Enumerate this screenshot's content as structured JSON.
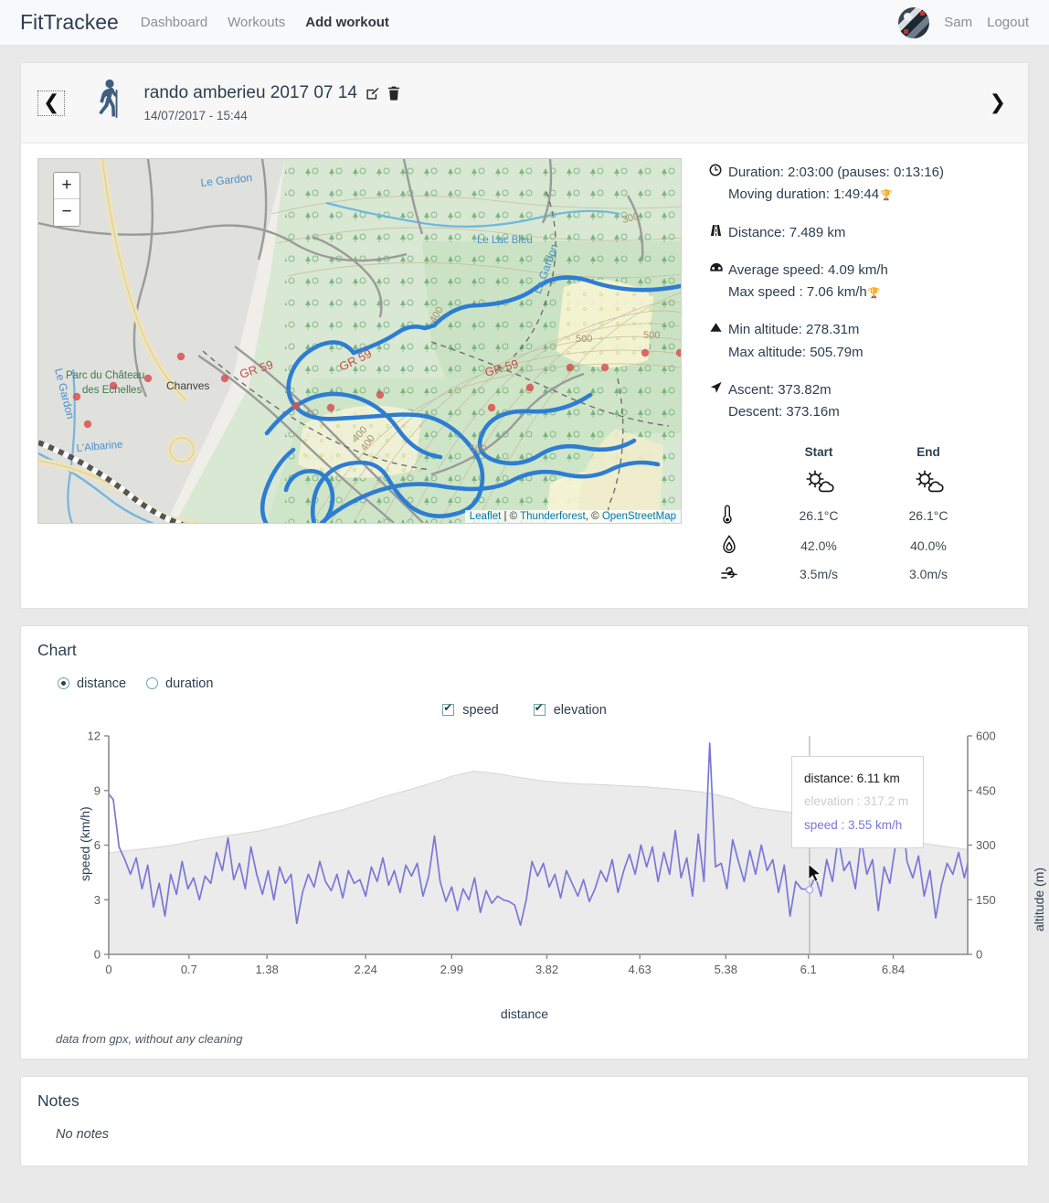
{
  "navbar": {
    "brand": "FitTrackee",
    "links": [
      {
        "label": "Dashboard",
        "active": false
      },
      {
        "label": "Workouts",
        "active": false
      },
      {
        "label": "Add workout",
        "active": true
      }
    ],
    "user": "Sam",
    "logout": "Logout"
  },
  "workout": {
    "prev_label": "❮",
    "next_label": "❯",
    "title": "rando amberieu 2017 07 14",
    "date": "14/07/2017 - 15:44",
    "sport": "hiking"
  },
  "map": {
    "zoom_in": "+",
    "zoom_out": "−",
    "attribution": {
      "leaflet": "Leaflet",
      "sep1": " | © ",
      "thunderforest": "Thunderforest",
      "sep2": ", © ",
      "osm": "OpenStreetMap"
    },
    "labels": [
      "Le Gardon",
      "Le Lac Bleu",
      "Parc du Château",
      "des Echelles",
      "Chanves",
      "L'Albarine",
      "GR 59",
      "300",
      "400",
      "500"
    ]
  },
  "stats": {
    "duration": "Duration: 2:03:00 (pauses: 0:13:16)",
    "moving_duration": "Moving duration: 1:49:44",
    "distance": "Distance: 7.489 km",
    "average_speed": "Average speed: 4.09 km/h",
    "max_speed": "Max speed : 7.06 km/h",
    "min_altitude": "Min altitude: 278.31m",
    "max_altitude": "Max altitude: 505.79m",
    "ascent": "Ascent: 373.82m",
    "descent": "Descent: 373.16m"
  },
  "weather": {
    "col_start": "Start",
    "col_end": "End",
    "icon_start": "sun-cloud",
    "icon_end": "sun-cloud",
    "rows": [
      {
        "icon": "thermometer-icon",
        "start": "26.1°C",
        "end": "26.1°C"
      },
      {
        "icon": "humidity-drop-icon",
        "start": "42.0%",
        "end": "40.0%"
      },
      {
        "icon": "wind-icon",
        "start": "3.5m/s",
        "end": "3.0m/s"
      }
    ]
  },
  "chart": {
    "title": "Chart",
    "radios": [
      {
        "label": "distance",
        "selected": true
      },
      {
        "label": "duration",
        "selected": false
      }
    ],
    "checkboxes": [
      {
        "label": "speed",
        "checked": true
      },
      {
        "label": "elevation",
        "checked": true
      }
    ],
    "note": "data from gpx, without any cleaning",
    "tooltip": {
      "distance": "distance: 6.11 km",
      "elevation": "elevation : 317.2 m",
      "speed": "speed : 3.55 km/h"
    }
  },
  "chart_data": {
    "type": "line",
    "title": "Chart",
    "xlabel": "distance",
    "ylabel": "speed (km/h)",
    "y2label": "altitude (m)",
    "grid": false,
    "legend": [
      "speed",
      "elevation"
    ],
    "legend_position": "top-center",
    "xlim": [
      0,
      7.489
    ],
    "ylim": [
      0,
      12
    ],
    "y2lim": [
      0,
      600
    ],
    "xticks": [
      0,
      0.7,
      1.38,
      2.24,
      2.99,
      3.82,
      4.63,
      5.38,
      6.1,
      6.84
    ],
    "xticklabels": [
      "0",
      "0.7",
      "1.38",
      "2.24",
      "2.99",
      "3.82",
      "4.63",
      "5.38",
      "6.1",
      "6.84"
    ],
    "yticks": [
      0,
      3,
      6,
      9,
      12
    ],
    "yticklabels": [
      "0",
      "3",
      "6",
      "9",
      "12"
    ],
    "y2ticks": [
      0,
      150,
      300,
      450,
      600
    ],
    "y2ticklabels": [
      "0",
      "150",
      "300",
      "450",
      "600"
    ],
    "colors": {
      "speed": "#7b76d6",
      "elevation": "#ebebeb",
      "elevation_line": "#d6d6d6"
    },
    "cursor": {
      "x": 6.11,
      "elevation": 317.2,
      "speed": 3.55
    },
    "series": [
      {
        "name": "elevation",
        "axis": "right",
        "unit": "m",
        "x": [
          0.0,
          0.19,
          0.37,
          0.56,
          0.75,
          0.94,
          1.12,
          1.31,
          1.5,
          1.68,
          1.87,
          2.06,
          2.25,
          2.43,
          2.62,
          2.81,
          3.0,
          3.18,
          3.37,
          3.56,
          3.74,
          3.93,
          4.12,
          4.31,
          4.49,
          4.68,
          4.87,
          5.06,
          5.24,
          5.43,
          5.62,
          5.8,
          5.99,
          6.18,
          6.37,
          6.55,
          6.74,
          6.93,
          7.12,
          7.3,
          7.49
        ],
        "values": [
          279,
          286,
          292,
          300,
          312,
          322,
          330,
          339,
          352,
          368,
          384,
          399,
          418,
          436,
          452,
          470,
          490,
          503,
          497,
          487,
          478,
          472,
          468,
          466,
          463,
          460,
          455,
          450,
          443,
          428,
          404,
          396,
          388,
          372,
          348,
          330,
          318,
          310,
          304,
          296,
          288
        ]
      },
      {
        "name": "speed",
        "axis": "left",
        "unit": "km/h",
        "x": [
          0.0,
          0.04,
          0.09,
          0.14,
          0.19,
          0.24,
          0.29,
          0.34,
          0.39,
          0.44,
          0.49,
          0.54,
          0.59,
          0.64,
          0.69,
          0.74,
          0.79,
          0.84,
          0.89,
          0.94,
          0.99,
          1.04,
          1.09,
          1.14,
          1.19,
          1.24,
          1.29,
          1.34,
          1.39,
          1.44,
          1.49,
          1.54,
          1.59,
          1.64,
          1.69,
          1.74,
          1.79,
          1.84,
          1.89,
          1.94,
          1.99,
          2.04,
          2.09,
          2.14,
          2.19,
          2.24,
          2.29,
          2.34,
          2.39,
          2.44,
          2.49,
          2.54,
          2.59,
          2.64,
          2.69,
          2.74,
          2.79,
          2.84,
          2.89,
          2.94,
          2.99,
          3.04,
          3.09,
          3.14,
          3.19,
          3.24,
          3.29,
          3.34,
          3.39,
          3.44,
          3.49,
          3.54,
          3.59,
          3.64,
          3.69,
          3.74,
          3.79,
          3.84,
          3.89,
          3.94,
          3.99,
          4.04,
          4.09,
          4.14,
          4.19,
          4.24,
          4.29,
          4.34,
          4.39,
          4.44,
          4.49,
          4.54,
          4.59,
          4.64,
          4.69,
          4.74,
          4.79,
          4.84,
          4.89,
          4.94,
          4.99,
          5.04,
          5.09,
          5.14,
          5.19,
          5.24,
          5.29,
          5.34,
          5.39,
          5.44,
          5.49,
          5.54,
          5.59,
          5.64,
          5.69,
          5.74,
          5.79,
          5.84,
          5.89,
          5.94,
          5.99,
          6.04,
          6.11,
          6.16,
          6.21,
          6.26,
          6.31,
          6.36,
          6.41,
          6.46,
          6.51,
          6.56,
          6.61,
          6.66,
          6.71,
          6.76,
          6.81,
          6.86,
          6.91,
          6.96,
          7.01,
          7.06,
          7.11,
          7.16,
          7.21,
          7.26,
          7.31,
          7.36,
          7.41,
          7.46,
          7.49
        ],
        "values": [
          8.8,
          8.5,
          5.9,
          5.2,
          4.4,
          5.3,
          3.6,
          4.9,
          2.6,
          3.9,
          2.1,
          4.4,
          3.3,
          5.1,
          3.6,
          4.2,
          3.0,
          4.3,
          3.9,
          5.6,
          4.6,
          6.4,
          4.1,
          5.0,
          3.6,
          5.9,
          4.4,
          3.3,
          4.6,
          3.0,
          4.8,
          3.9,
          4.4,
          1.7,
          3.4,
          4.4,
          3.7,
          5.1,
          4.0,
          3.5,
          4.4,
          3.1,
          4.6,
          3.9,
          4.1,
          3.2,
          4.8,
          4.0,
          5.3,
          3.8,
          4.6,
          3.4,
          4.9,
          4.3,
          5.0,
          3.2,
          4.3,
          6.5,
          4.0,
          2.9,
          3.7,
          2.4,
          3.6,
          3.0,
          4.2,
          2.3,
          3.5,
          2.8,
          3.2,
          3.0,
          2.9,
          2.7,
          1.6,
          3.0,
          5.1,
          4.3,
          5.0,
          3.7,
          4.4,
          3.1,
          4.6,
          3.9,
          3.2,
          4.1,
          2.9,
          3.6,
          4.6,
          4.0,
          5.2,
          3.4,
          4.6,
          5.5,
          4.4,
          6.0,
          4.8,
          5.9,
          4.0,
          5.6,
          4.4,
          6.8,
          4.2,
          5.3,
          3.2,
          6.6,
          4.0,
          11.6,
          4.8,
          5.0,
          3.6,
          6.3,
          5.1,
          4.0,
          5.7,
          4.4,
          6.0,
          4.6,
          5.2,
          3.4,
          4.9,
          2.1,
          4.0,
          3.6,
          3.55,
          4.3,
          3.2,
          5.2,
          4.0,
          6.4,
          4.6,
          5.1,
          3.6,
          6.3,
          4.4,
          5.2,
          2.4,
          4.8,
          3.9,
          6.0,
          8.6,
          5.1,
          4.2,
          5.4,
          3.2,
          4.6,
          2.0,
          3.8,
          5.0,
          4.4,
          5.6,
          4.2,
          5.0,
          4.4
        ]
      }
    ]
  },
  "notes": {
    "title": "Notes",
    "body": "No notes"
  }
}
